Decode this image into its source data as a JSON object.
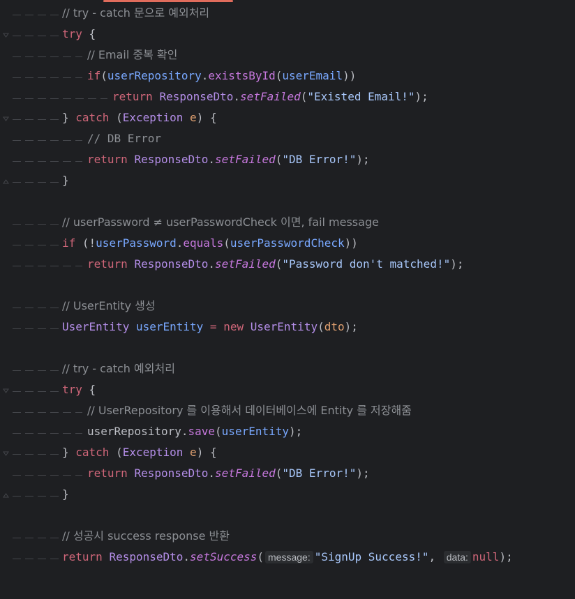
{
  "lines": {
    "l1": {
      "comment": "// try - catch 문으로 예외처리"
    },
    "l2": {
      "kw_try": "try",
      "brace": " {"
    },
    "l3": {
      "comment": "// Email 중복 확인"
    },
    "l4": {
      "kw_if": "if",
      "p1": "(",
      "obj": "userRepository",
      "dot": ".",
      "method": "existsById",
      "p2": "(",
      "arg": "userEmail",
      "p3": "))"
    },
    "l5": {
      "kw_return": "return",
      "cls": "ResponseDto",
      "dot": ".",
      "method": "setFailed",
      "p1": "(",
      "str": "\"Existed Email!\"",
      "p2": ");"
    },
    "l6": {
      "close": "} ",
      "kw_catch": "catch",
      "p1": " (",
      "exc": "Exception",
      "sp": " ",
      "e": "e",
      "p2": ") {"
    },
    "l7": {
      "comment": "// DB Error"
    },
    "l8": {
      "kw_return": "return",
      "cls": "ResponseDto",
      "dot": ".",
      "method": "setFailed",
      "p1": "(",
      "str": "\"DB Error!\"",
      "p2": ");"
    },
    "l9": {
      "close": "}"
    },
    "l11": {
      "comment": "// userPassword ≠ userPasswordCheck 이면, fail message"
    },
    "l12": {
      "kw_if": "if",
      "p1": " (!",
      "obj": "userPassword",
      "dot": ".",
      "method": "equals",
      "p2": "(",
      "arg": "userPasswordCheck",
      "p3": "))"
    },
    "l13": {
      "kw_return": "return",
      "cls": "ResponseDto",
      "dot": ".",
      "method": "setFailed",
      "p1": "(",
      "str": "\"Password don't matched!\"",
      "p2": ");"
    },
    "l15": {
      "comment": "// UserEntity 생성"
    },
    "l16": {
      "type": "UserEntity",
      "sp": " ",
      "var": "userEntity",
      "eq": " = ",
      "kw_new": "new",
      "sp2": " ",
      "ctor": "UserEntity",
      "p1": "(",
      "arg": "dto",
      "p2": ");"
    },
    "l18": {
      "comment": "// try - catch 예외처리"
    },
    "l19": {
      "kw_try": "try",
      "brace": " {"
    },
    "l20": {
      "comment": "// UserRepository 를 이용해서 데이터베이스에 Entity 를 저장해줌"
    },
    "l21": {
      "obj": "userRepository",
      "dot": ".",
      "method": "save",
      "p1": "(",
      "arg": "userEntity",
      "p2": ");"
    },
    "l22": {
      "close": "} ",
      "kw_catch": "catch",
      "p1": " (",
      "exc": "Exception",
      "sp": " ",
      "e": "e",
      "p2": ") {"
    },
    "l23": {
      "kw_return": "return",
      "cls": "ResponseDto",
      "dot": ".",
      "method": "setFailed",
      "p1": "(",
      "str": "\"DB Error!\"",
      "p2": ");"
    },
    "l24": {
      "close": "}"
    },
    "l26": {
      "comment": "// 성공시 success response 반환"
    },
    "l27": {
      "kw_return": "return",
      "cls": "ResponseDto",
      "dot": ".",
      "method": "setSuccess",
      "p1": "(",
      "hint1": "message:",
      "str": "\"SignUp Success!\"",
      "comma": ",",
      "hint2": "data:",
      "kw_null": "null",
      "p2": ");"
    }
  },
  "colors": {
    "background": "#1e1f22",
    "keyword": "#cf6679",
    "comment": "#8c8f94",
    "class": "#b48ee8",
    "method": "#c678dd",
    "variable": "#79a8ff",
    "string": "#a8c7fa",
    "accent": "#e06c5c"
  }
}
